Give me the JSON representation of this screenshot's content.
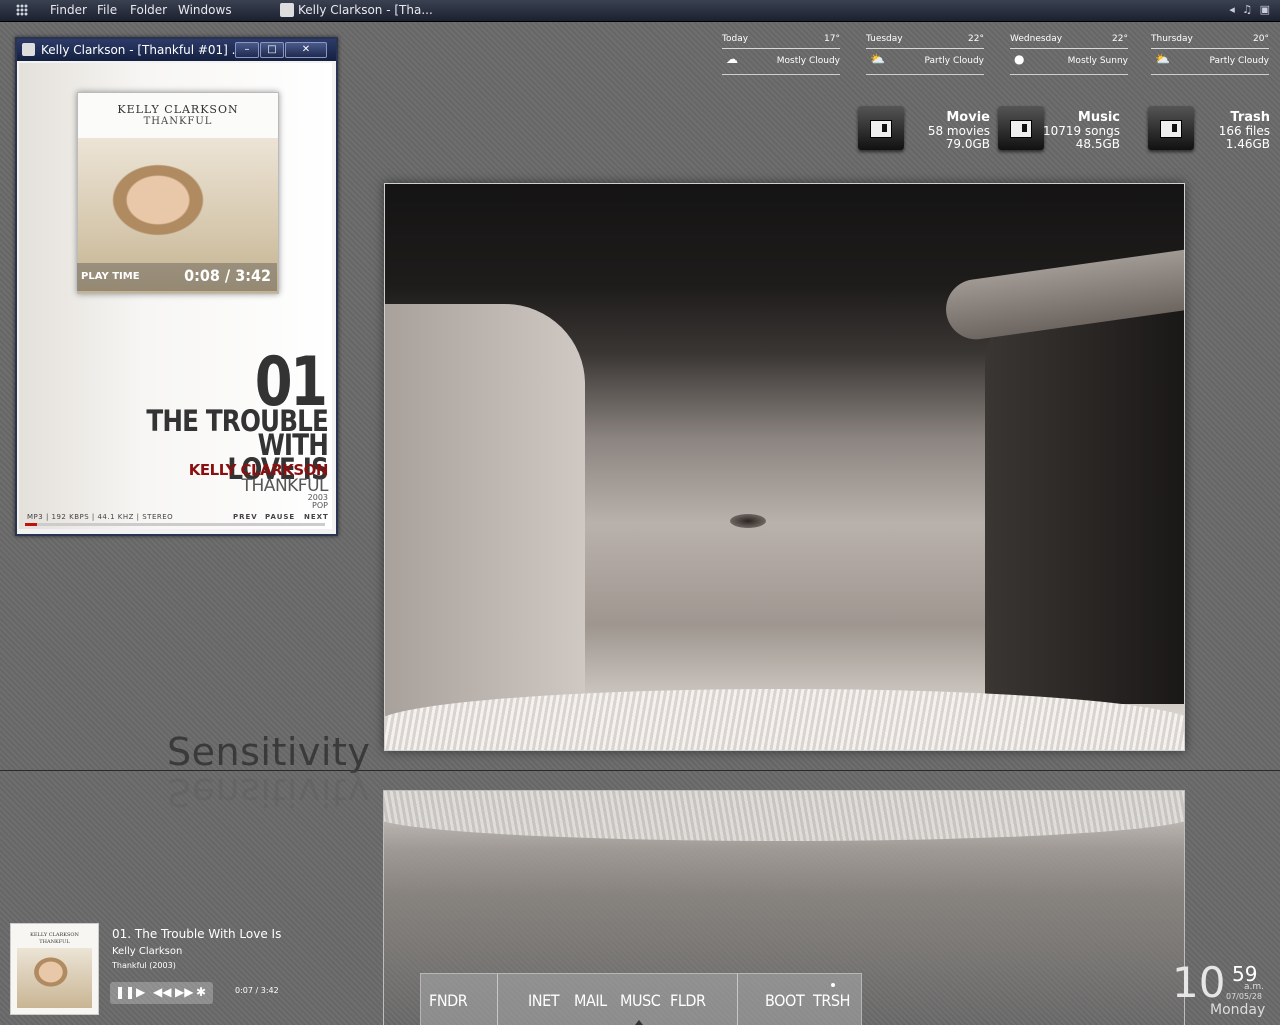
{
  "menubar": {
    "items": [
      "Finder",
      "File",
      "Folder",
      "Windows"
    ],
    "task_title": "Kelly Clarkson - [Tha..."
  },
  "player": {
    "window_title": "Kelly Clarkson - [Thankful #01] ...",
    "cover_artist": "KELLY CLARKSON",
    "cover_album": "THANKFUL",
    "play_time_label": "PLAY TIME",
    "play_time_value": "0:08 / 3:42",
    "track_number": "01",
    "track_title_line1": "THE TROUBLE WITH",
    "track_title_line2": "LOVE IS",
    "artist": "KELLY CLARKSON",
    "album": "THANKFUL",
    "year": "2003",
    "genre": "POP",
    "format_info": "MP3 | 192 KBPS | 44.1 KHZ | STEREO",
    "prev_label": "PREV",
    "pause_label": "PAUSE",
    "next_label": "NEXT",
    "progress": 0.04
  },
  "weather": [
    {
      "day": "Today",
      "temp": "17°",
      "condition": "Mostly Cloudy",
      "icon": "cloud-icon"
    },
    {
      "day": "Tuesday",
      "temp": "22°",
      "condition": "Partly Cloudy",
      "icon": "partly-cloudy-icon"
    },
    {
      "day": "Wednesday",
      "temp": "22°",
      "condition": "Mostly Sunny",
      "icon": "sun-icon"
    },
    {
      "day": "Thursday",
      "temp": "20°",
      "condition": "Partly Cloudy",
      "icon": "partly-cloudy-icon"
    }
  ],
  "drives": [
    {
      "title": "Movie",
      "count": "58 movies",
      "size": "79.0GB"
    },
    {
      "title": "Music",
      "count": "10719 songs",
      "size": "48.5GB"
    },
    {
      "title": "Trash",
      "count": "166 files",
      "size": "1.46GB"
    }
  ],
  "desktop": {
    "caption": "Sensitivity"
  },
  "now_playing": {
    "cover_artist": "KELLY CLARKSON",
    "cover_album": "THANKFUL",
    "title": "01. The Trouble With Love Is",
    "artist": "Kelly Clarkson",
    "album": "Thankful (2003)",
    "time": "0:07 / 3:42"
  },
  "dock": {
    "items": [
      "FNDR",
      "INET",
      "MAIL",
      "MUSC",
      "FLDR",
      "BOOT",
      "TRSH"
    ]
  },
  "clock": {
    "hour": "10",
    "minute": "59",
    "ampm": "a.m.",
    "date": "07/05/28",
    "weekday": "Monday"
  }
}
